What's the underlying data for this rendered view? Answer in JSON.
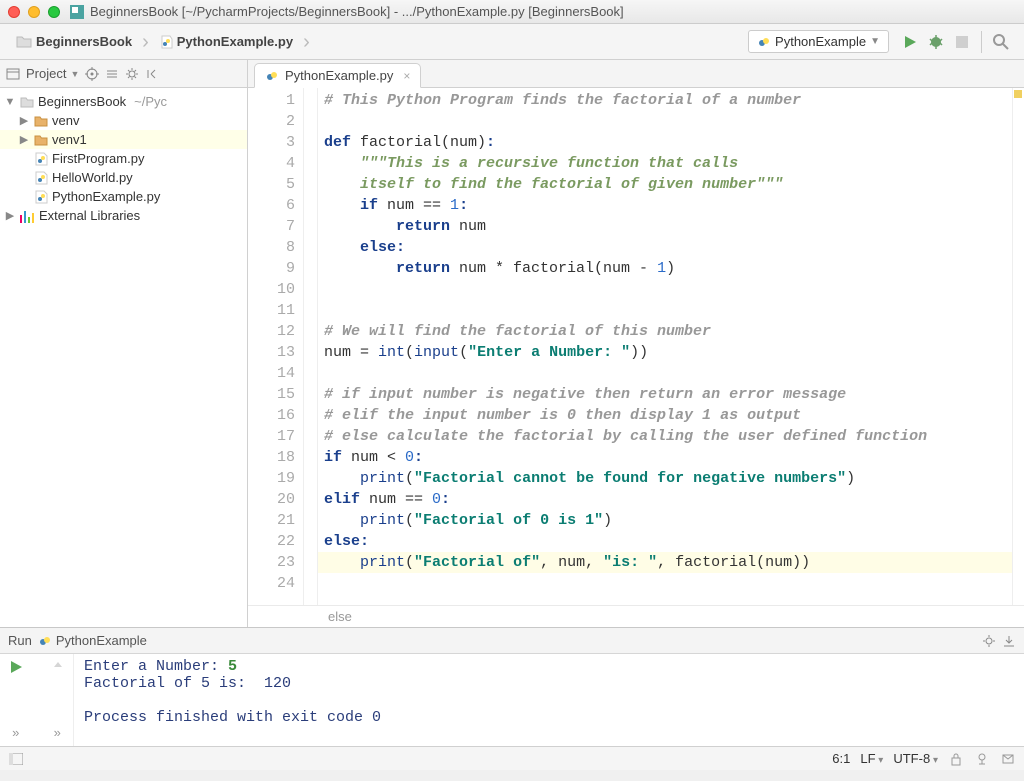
{
  "window": {
    "title": "BeginnersBook [~/PycharmProjects/BeginnersBook] - .../PythonExample.py [BeginnersBook]"
  },
  "breadcrumb": {
    "project": "BeginnersBook",
    "file": "PythonExample.py"
  },
  "run_config": {
    "name": "PythonExample"
  },
  "project_tool": {
    "label": "Project"
  },
  "tree": {
    "root": "BeginnersBook",
    "root_path": "~/Pyc",
    "items": [
      {
        "name": "venv",
        "type": "folder"
      },
      {
        "name": "venv1",
        "type": "folder"
      },
      {
        "name": "FirstProgram.py",
        "type": "py"
      },
      {
        "name": "HelloWorld.py",
        "type": "py"
      },
      {
        "name": "PythonExample.py",
        "type": "py"
      }
    ],
    "external": "External Libraries"
  },
  "tabs": {
    "active": "PythonExample.py"
  },
  "code_lines": [
    {
      "n": 1,
      "seg": [
        [
          "com",
          "# This Python Program finds the factorial of a number"
        ]
      ]
    },
    {
      "n": 2,
      "seg": []
    },
    {
      "n": 3,
      "seg": [
        [
          "kw",
          "def"
        ],
        [
          "norm",
          " factorial(num)"
        ],
        [
          "kw",
          ":"
        ]
      ]
    },
    {
      "n": 4,
      "seg": [
        [
          "doc",
          "    \"\"\"This is a recursive function that calls"
        ]
      ]
    },
    {
      "n": 5,
      "seg": [
        [
          "doc",
          "    itself to find the factorial of given number\"\"\""
        ]
      ]
    },
    {
      "n": 6,
      "seg": [
        [
          "norm",
          "    "
        ],
        [
          "kw",
          "if"
        ],
        [
          "norm",
          " num == "
        ],
        [
          "num",
          "1"
        ],
        [
          "kw",
          ":"
        ]
      ]
    },
    {
      "n": 7,
      "seg": [
        [
          "norm",
          "        "
        ],
        [
          "kw",
          "return"
        ],
        [
          "norm",
          " num"
        ]
      ]
    },
    {
      "n": 8,
      "seg": [
        [
          "norm",
          "    "
        ],
        [
          "kw",
          "else"
        ],
        [
          "kw",
          ":"
        ]
      ]
    },
    {
      "n": 9,
      "seg": [
        [
          "norm",
          "        "
        ],
        [
          "kw",
          "return"
        ],
        [
          "norm",
          " num * factorial(num - "
        ],
        [
          "num",
          "1"
        ],
        [
          "norm",
          ")"
        ]
      ]
    },
    {
      "n": 10,
      "seg": []
    },
    {
      "n": 11,
      "seg": []
    },
    {
      "n": 12,
      "seg": [
        [
          "com",
          "# We will find the factorial of this number"
        ]
      ]
    },
    {
      "n": 13,
      "seg": [
        [
          "norm",
          "num = "
        ],
        [
          "bi",
          "int"
        ],
        [
          "norm",
          "("
        ],
        [
          "bi",
          "input"
        ],
        [
          "norm",
          "("
        ],
        [
          "str",
          "\"Enter a Number: \""
        ],
        [
          "norm",
          "))"
        ]
      ]
    },
    {
      "n": 14,
      "seg": []
    },
    {
      "n": 15,
      "seg": [
        [
          "com",
          "# if input number is negative then return an error message"
        ]
      ]
    },
    {
      "n": 16,
      "seg": [
        [
          "com",
          "# elif the input number is 0 then display 1 as output"
        ]
      ]
    },
    {
      "n": 17,
      "seg": [
        [
          "com",
          "# else calculate the factorial by calling the user defined function"
        ]
      ]
    },
    {
      "n": 18,
      "seg": [
        [
          "kw",
          "if"
        ],
        [
          "norm",
          " num < "
        ],
        [
          "num",
          "0"
        ],
        [
          "kw",
          ":"
        ]
      ]
    },
    {
      "n": 19,
      "seg": [
        [
          "norm",
          "    "
        ],
        [
          "bi",
          "print"
        ],
        [
          "norm",
          "("
        ],
        [
          "str",
          "\"Factorial cannot be found for negative numbers\""
        ],
        [
          "norm",
          ")"
        ]
      ]
    },
    {
      "n": 20,
      "seg": [
        [
          "kw",
          "elif"
        ],
        [
          "norm",
          " num == "
        ],
        [
          "num",
          "0"
        ],
        [
          "kw",
          ":"
        ]
      ]
    },
    {
      "n": 21,
      "seg": [
        [
          "norm",
          "    "
        ],
        [
          "bi",
          "print"
        ],
        [
          "norm",
          "("
        ],
        [
          "str",
          "\"Factorial of 0 is 1\""
        ],
        [
          "norm",
          ")"
        ]
      ]
    },
    {
      "n": 22,
      "seg": [
        [
          "kw",
          "else"
        ],
        [
          "kw",
          ":"
        ]
      ]
    },
    {
      "n": 23,
      "seg": [
        [
          "norm",
          "    "
        ],
        [
          "bi",
          "print"
        ],
        [
          "norm",
          "("
        ],
        [
          "str",
          "\"Factorial of\""
        ],
        [
          "norm",
          ", num, "
        ],
        [
          "str",
          "\"is: \""
        ],
        [
          "norm",
          ", factorial(num))"
        ]
      ]
    },
    {
      "n": 24,
      "seg": []
    }
  ],
  "code_highlight_index": 22,
  "crumb_path": "else",
  "run_panel": {
    "title_prefix": "Run",
    "title": "PythonExample",
    "output": [
      {
        "parts": [
          [
            "norm",
            "Enter a Number: "
          ],
          [
            "user",
            "5"
          ]
        ]
      },
      {
        "parts": [
          [
            "norm",
            "Factorial of 5 is:  120"
          ]
        ]
      },
      {
        "parts": [
          [
            "norm",
            ""
          ]
        ]
      },
      {
        "parts": [
          [
            "norm",
            "Process finished with exit code 0"
          ]
        ]
      }
    ]
  },
  "status": {
    "pos": "6:1",
    "line_sep": "LF",
    "encoding": "UTF-8"
  }
}
